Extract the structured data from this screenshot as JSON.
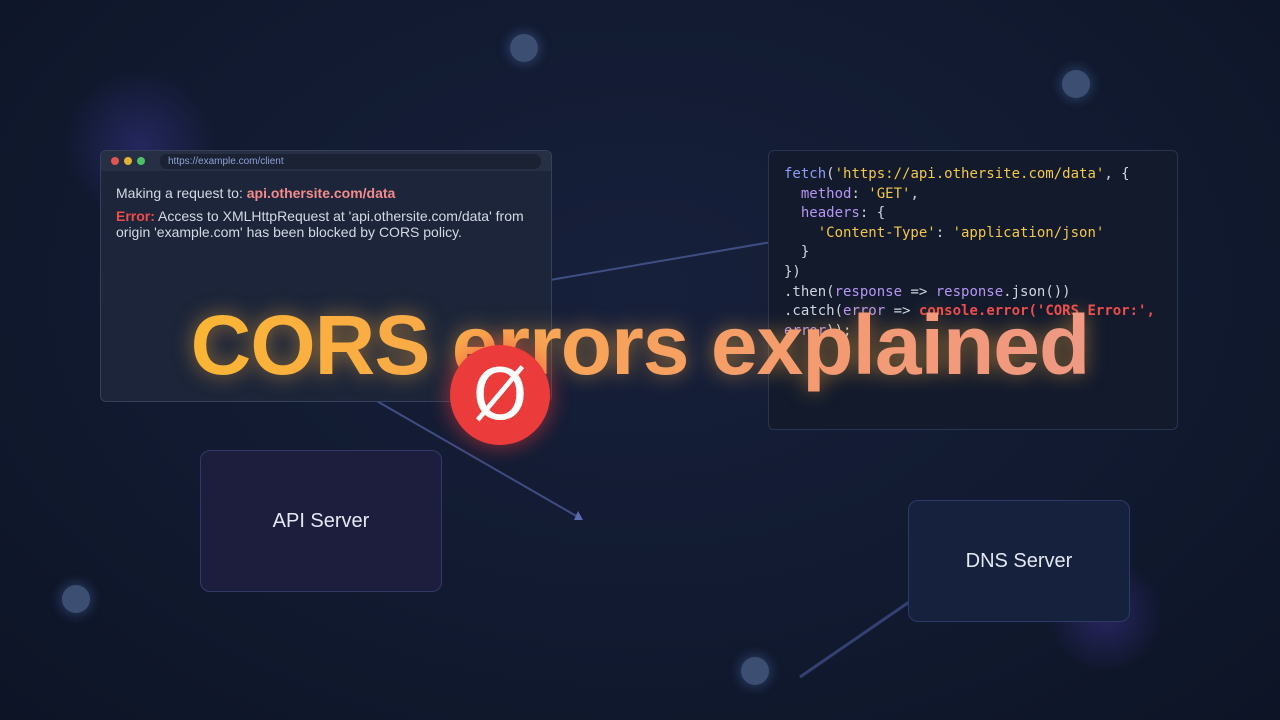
{
  "browser": {
    "url": "https://example.com/client",
    "request_prefix": "Making a request to:",
    "request_host": "api.othersite.com/data",
    "error_label": "Error:",
    "error_text": "Access to XMLHttpRequest at 'api.othersite.com/data' from origin 'example.com' has been blocked by CORS policy."
  },
  "code": {
    "lines": [
      [
        {
          "t": "fetch",
          "c": "fn"
        },
        {
          "t": "(",
          "c": ""
        },
        {
          "t": "'https://api.othersite.com/data'",
          "c": "str"
        },
        {
          "t": ", {",
          "c": ""
        }
      ],
      [
        {
          "t": "  method",
          "c": "key"
        },
        {
          "t": ": ",
          "c": ""
        },
        {
          "t": "'GET'",
          "c": "str"
        },
        {
          "t": ",",
          "c": ""
        }
      ],
      [
        {
          "t": "  headers",
          "c": "key"
        },
        {
          "t": ": {",
          "c": ""
        }
      ],
      [
        {
          "t": "    'Content-Type'",
          "c": "str"
        },
        {
          "t": ": ",
          "c": ""
        },
        {
          "t": "'application/json'",
          "c": "str"
        }
      ],
      [
        {
          "t": "  }",
          "c": ""
        }
      ],
      [
        {
          "t": "})",
          "c": ""
        }
      ],
      [
        {
          "t": ".then(",
          "c": ""
        },
        {
          "t": "response",
          "c": "key"
        },
        {
          "t": " => ",
          "c": ""
        },
        {
          "t": "response",
          "c": "key"
        },
        {
          "t": ".json())",
          "c": ""
        }
      ],
      [
        {
          "t": ".catch(",
          "c": ""
        },
        {
          "t": "error",
          "c": "key"
        },
        {
          "t": " => ",
          "c": ""
        },
        {
          "t": "console.error('CORS Error:',",
          "c": "err"
        }
      ],
      [
        {
          "t": "error",
          "c": "key"
        },
        {
          "t": "));",
          "c": ""
        }
      ]
    ]
  },
  "servers": {
    "api": "API Server",
    "dns": "DNS Server"
  },
  "title": "CORS errors explained",
  "blocked_icon": {
    "glyph": "Ø",
    "color": "#ec3b3b"
  },
  "colors": {
    "background": "#111a30",
    "title_gradient_start": "#fbbf24",
    "title_gradient_end": "#ec9891",
    "error": "#ef4c4c"
  }
}
